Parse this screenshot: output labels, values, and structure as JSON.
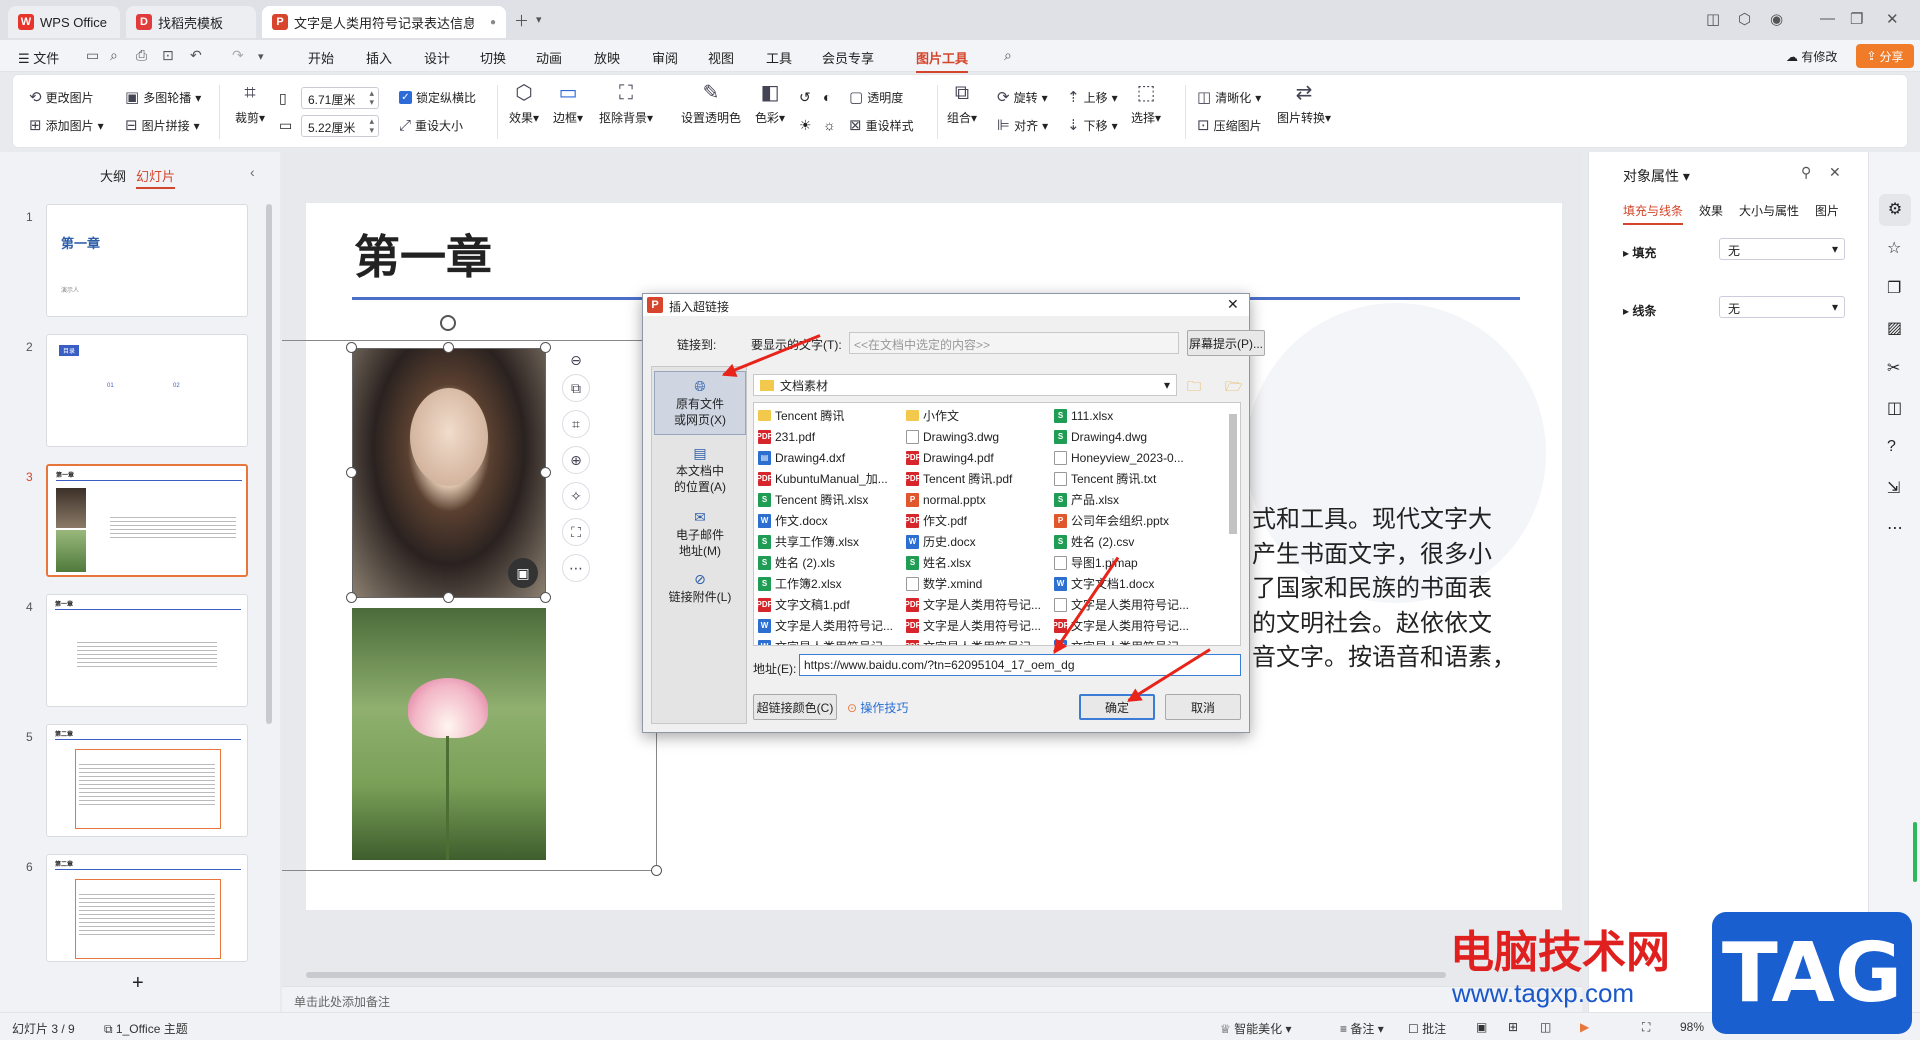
{
  "tabs": [
    {
      "label": "WPS Office",
      "logo": "W",
      "logo_color": "#e8352b"
    },
    {
      "label": "找稻壳模板",
      "logo": "D",
      "logo_color": "#e03c3c"
    },
    {
      "label": "文字是人类用符号记录表达信息以",
      "logo": "P",
      "logo_color": "#d7462c"
    }
  ],
  "menubar": {
    "file": "☰ 文件",
    "items": [
      "开始",
      "插入",
      "设计",
      "切换",
      "动画",
      "放映",
      "审阅",
      "视图",
      "工具",
      "会员专享",
      "图片工具"
    ],
    "active": "图片工具",
    "modified": "有修改",
    "share": "分享"
  },
  "ribbon": {
    "change_pic": "更改图片",
    "multi_outline": "多图轮播",
    "add_pic": "添加图片",
    "pic_splice": "图片拼接",
    "crop": "裁剪",
    "width": "6.71厘米",
    "height": "5.22厘米",
    "lock_ratio": "锁定纵横比",
    "reset_size": "重设大小",
    "effect": "效果",
    "border": "边框",
    "remove_bg": "抠除背景",
    "set_transparent": "设置透明色",
    "color": "色彩",
    "transparency": "透明度",
    "reset_style": "重设样式",
    "group": "组合",
    "rotate": "旋转",
    "align": "对齐",
    "up": "上移",
    "down": "下移",
    "select": "选择",
    "sharpen": "清晰化",
    "compress": "压缩图片",
    "convert": "图片转换"
  },
  "left_panel": {
    "tab_outline": "大纲",
    "tab_slides": "幻灯片",
    "add": "+"
  },
  "slides": [
    {
      "num": "1",
      "title": "第一章",
      "sub": "演示人"
    },
    {
      "num": "2",
      "title": "目录",
      "items": [
        "01",
        "02"
      ]
    },
    {
      "num": "3",
      "title": "第一章"
    },
    {
      "num": "4",
      "title": "第一章"
    },
    {
      "num": "5",
      "title": "第二章"
    },
    {
      "num": "6",
      "title": "第二章"
    }
  ],
  "slide": {
    "title": "第一章",
    "body_lines": [
      "式和工具。现代文字大",
      "产生书面文字，很多小",
      "了国家和民族的书面表",
      "的文明社会。赵依依文",
      "音文字。按语音和语素，"
    ]
  },
  "right_panel": {
    "title": "对象属性",
    "tabs": [
      "填充与线条",
      "效果",
      "大小与属性",
      "图片"
    ],
    "fill_label": "填充",
    "fill_value": "无",
    "line_label": "线条",
    "line_value": "无"
  },
  "notes_placeholder": "单击此处添加备注",
  "status": {
    "slide_count": "幻灯片 3 / 9",
    "theme": "1_Office 主题",
    "beautify": "智能美化",
    "notes": "备注",
    "comments": "批注",
    "zoom": "98%"
  },
  "dialog": {
    "title": "插入超链接",
    "link_to": "链接到:",
    "display_text_label": "要显示的文字(T):",
    "display_text_value": "<<在文档中选定的内容>>",
    "screen_tip": "屏幕提示(P)...",
    "nav": [
      "原有文件\n或网页(X)",
      "本文档中\n的位置(A)",
      "电子邮件\n地址(M)",
      "链接附件(L)"
    ],
    "folder": "文档素材",
    "files": [
      [
        {
          "n": "Tencent 腾讯",
          "t": "folder"
        },
        {
          "n": "小作文",
          "t": "folder"
        },
        {
          "n": "111.xlsx",
          "t": "xls"
        }
      ],
      [
        {
          "n": "231.pdf",
          "t": "pdf"
        },
        {
          "n": "Drawing3.dwg",
          "t": "txt"
        },
        {
          "n": "Drawing4.dwg",
          "t": "xls"
        }
      ],
      [
        {
          "n": "Drawing4.dxf",
          "t": "dxf"
        },
        {
          "n": "Drawing4.pdf",
          "t": "pdf"
        },
        {
          "n": "Honeyview_2023-0...",
          "t": "txt"
        }
      ],
      [
        {
          "n": "KubuntuManual_加...",
          "t": "pdf"
        },
        {
          "n": "Tencent 腾讯.pdf",
          "t": "pdf"
        },
        {
          "n": "Tencent 腾讯.txt",
          "t": "txt"
        }
      ],
      [
        {
          "n": "Tencent 腾讯.xlsx",
          "t": "xls"
        },
        {
          "n": "normal.pptx",
          "t": "ppt"
        },
        {
          "n": "产品.xlsx",
          "t": "xls"
        }
      ],
      [
        {
          "n": "作文.docx",
          "t": "doc"
        },
        {
          "n": "作文.pdf",
          "t": "pdf"
        },
        {
          "n": "公司年会组织.pptx",
          "t": "ppt"
        }
      ],
      [
        {
          "n": "共享工作簿.xlsx",
          "t": "xls"
        },
        {
          "n": "历史.docx",
          "t": "doc"
        },
        {
          "n": "姓名 (2).csv",
          "t": "xls"
        }
      ],
      [
        {
          "n": "姓名 (2).xls",
          "t": "xls"
        },
        {
          "n": "姓名.xlsx",
          "t": "xls"
        },
        {
          "n": "导图1.pimap",
          "t": "txt"
        }
      ],
      [
        {
          "n": "工作簿2.xlsx",
          "t": "xls"
        },
        {
          "n": "数学.xmind",
          "t": "txt"
        },
        {
          "n": "文字文档1.docx",
          "t": "doc"
        }
      ],
      [
        {
          "n": "文字文稿1.pdf",
          "t": "pdf"
        },
        {
          "n": "文字是人类用符号记...",
          "t": "pdf"
        },
        {
          "n": "文字是人类用符号记...",
          "t": "txt"
        }
      ],
      [
        {
          "n": "文字是人类用符号记...",
          "t": "doc"
        },
        {
          "n": "文字是人类用符号记...",
          "t": "pdf"
        },
        {
          "n": "文字是人类用符号记...",
          "t": "pdf"
        }
      ],
      [
        {
          "n": "文字是人类用符号记...",
          "t": "doc"
        },
        {
          "n": "文字是人类用符号记...",
          "t": "pdf"
        },
        {
          "n": "文字是人类用符号记...",
          "t": "doc"
        }
      ]
    ],
    "address_label": "地址(E):",
    "address_value": "https://www.baidu.com/?tn=62095104_17_oem_dg",
    "link_color": "超链接颜色(C)",
    "tips": "操作技巧",
    "ok": "确定",
    "cancel": "取消"
  },
  "watermark": {
    "text": "电脑技术网",
    "url": "www.tagxp.com",
    "logo": "TAG"
  },
  "file_colors": {
    "xls": "#1f9d55",
    "pdf": "#d7262b",
    "doc": "#2c6fd1",
    "ppt": "#e0572b",
    "txt": "#999999",
    "dxf": "#2c6fd1",
    "folder": "#f2c94c"
  }
}
